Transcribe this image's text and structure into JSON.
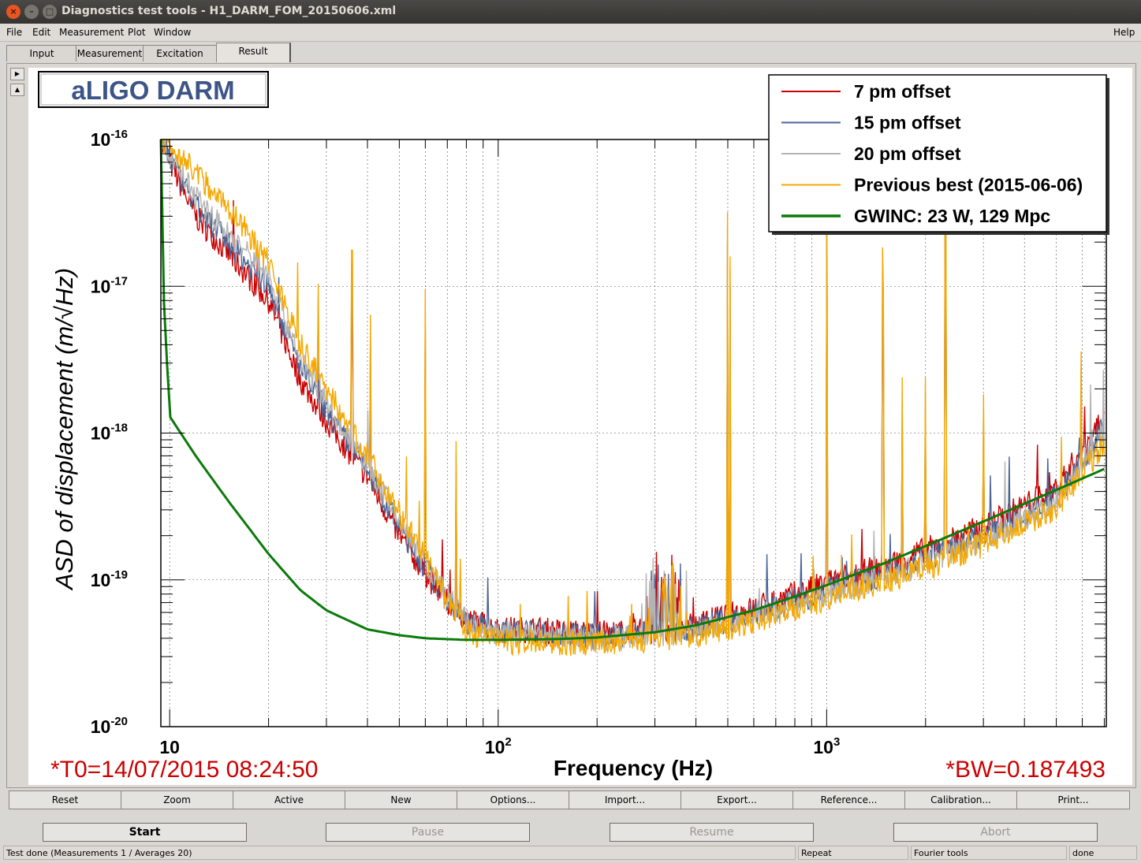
{
  "window": {
    "title": "Diagnostics test tools - H1_DARM_FOM_20150606.xml"
  },
  "menu": {
    "file": "File",
    "edit": "Edit",
    "measurement": "Measurement",
    "plot": "Plot",
    "window": "Window",
    "help": "Help"
  },
  "tabs": [
    "Input",
    "Measurement",
    "Excitation",
    "Result"
  ],
  "plot": {
    "header": "aLIGO DARM",
    "t0": "*T0=14/07/2015 08:24:50",
    "bw": "*BW=0.187493"
  },
  "chart_data": {
    "type": "line",
    "xscale": "log",
    "yscale": "log",
    "xlim": [
      9.4,
      7100
    ],
    "ylim": [
      1e-20,
      1e-16
    ],
    "xlabel": "Frequency (Hz)",
    "ylabel": "ASD of displacement  (m/√Hz)",
    "xticklabels": [
      "10",
      "10^2",
      "10^3"
    ],
    "yticklabels": [
      "10^-16",
      "10^-17",
      "10^-18",
      "10^-19",
      "10^-20"
    ],
    "grid": true,
    "legend_position": "top-right",
    "series": [
      {
        "name": "7 pm offset",
        "color": "#cc0000",
        "x": [
          9.5,
          10,
          12,
          15,
          20,
          25,
          30,
          40,
          50,
          60,
          70,
          80,
          100,
          130,
          160,
          200,
          300,
          400,
          600,
          800,
          1000,
          1500,
          2000,
          3000,
          5000,
          7000
        ],
        "y": [
          1e-16,
          7e-17,
          3e-17,
          1.7e-17,
          8e-18,
          2.3e-18,
          1.2e-18,
          5e-19,
          2e-19,
          1.1e-19,
          7e-20,
          5.4e-20,
          4.6e-20,
          4.6e-20,
          4.4e-20,
          4.3e-20,
          4.5e-20,
          5e-20,
          6.4e-20,
          8e-20,
          9.5e-20,
          1.25e-19,
          1.6e-19,
          2.3e-19,
          4.2e-19,
          1.3e-18
        ]
      },
      {
        "name": "15 pm offset",
        "color": "#4a6496",
        "x": [
          9.5,
          10,
          12,
          15,
          20,
          25,
          30,
          40,
          50,
          60,
          70,
          80,
          100,
          130,
          160,
          200,
          300,
          400,
          600,
          800,
          1000,
          1500,
          2000,
          3000,
          5000,
          7000
        ],
        "y": [
          1e-16,
          7.5e-17,
          3.5e-17,
          2e-17,
          1e-17,
          2.8e-18,
          1.4e-18,
          5.5e-19,
          2.3e-19,
          1.2e-19,
          7.5e-20,
          5.2e-20,
          4.4e-20,
          4.4e-20,
          4.2e-20,
          4.1e-20,
          4.3e-20,
          4.7e-20,
          5.8e-20,
          7.2e-20,
          8.5e-20,
          1.1e-19,
          1.4e-19,
          2e-19,
          3.6e-19,
          1.1e-18
        ]
      },
      {
        "name": "20 pm offset",
        "color": "#b4b4b4",
        "x": [
          9.5,
          10,
          12,
          15,
          20,
          25,
          30,
          40,
          50,
          60,
          70,
          80,
          100,
          130,
          160,
          200,
          300,
          400,
          600,
          800,
          1000,
          1500,
          2000,
          3000,
          5000,
          7000
        ],
        "y": [
          1e-16,
          8e-17,
          4e-17,
          2.3e-17,
          1.2e-17,
          3.2e-18,
          1.6e-18,
          6e-19,
          2.5e-19,
          1.3e-19,
          7.8e-20,
          5.2e-20,
          4.3e-20,
          4.3e-20,
          4.1e-20,
          4e-20,
          4.2e-20,
          4.5e-20,
          5.5e-20,
          6.8e-20,
          8e-20,
          1.05e-19,
          1.3e-19,
          1.9e-19,
          3.4e-19,
          1e-18
        ]
      },
      {
        "name": "Previous best (2015-06-06)",
        "color": "#f5a800",
        "x": [
          9.5,
          10,
          12,
          15,
          20,
          25,
          30,
          40,
          50,
          60,
          70,
          80,
          100,
          130,
          160,
          200,
          300,
          400,
          600,
          800,
          1000,
          1500,
          2000,
          3000,
          5000,
          7000
        ],
        "y": [
          1e-16,
          9e-17,
          6e-17,
          3.5e-17,
          1.5e-17,
          4e-18,
          2e-18,
          7e-19,
          2.8e-19,
          1.4e-19,
          7e-20,
          4.5e-20,
          3.8e-20,
          3.8e-20,
          3.7e-20,
          3.7e-20,
          3.9e-20,
          4.2e-20,
          5.2e-20,
          6.4e-20,
          7.5e-20,
          9.8e-20,
          1.2e-19,
          1.75e-19,
          3.1e-19,
          8.5e-19
        ]
      },
      {
        "name": "GWINC: 23 W, 129 Mpc",
        "color": "#0a7a0a",
        "x": [
          9.4,
          9.6,
          10,
          12,
          15,
          20,
          25,
          30,
          40,
          50,
          60,
          80,
          100,
          150,
          200,
          300,
          400,
          600,
          800,
          1000,
          1500,
          2000,
          3000,
          5000,
          7000
        ],
        "y": [
          1e-16,
          8e-18,
          1.3e-18,
          7e-19,
          3.5e-19,
          1.5e-19,
          8.5e-20,
          6.2e-20,
          4.6e-20,
          4.2e-20,
          4e-20,
          3.9e-20,
          3.9e-20,
          3.95e-20,
          4.05e-20,
          4.4e-20,
          4.9e-20,
          6.2e-20,
          7.7e-20,
          9.2e-20,
          1.3e-19,
          1.7e-19,
          2.5e-19,
          4.1e-19,
          5.7e-19
        ]
      }
    ],
    "lines_peaks": [
      {
        "x": 28.3,
        "y": 1.3e-17
      },
      {
        "x": 35.9,
        "y": 2.2e-17
      },
      {
        "x": 40.9,
        "y": 8e-18
      },
      {
        "x": 60,
        "y": 1.2e-17
      },
      {
        "x": 74.5,
        "y": 1.1e-18
      },
      {
        "x": 500,
        "y": 4e-17
      },
      {
        "x": 508,
        "y": 2e-17
      },
      {
        "x": 1000,
        "y": 1e-16
      },
      {
        "x": 1476,
        "y": 2.3e-17
      },
      {
        "x": 1484,
        "y": 1.2e-17
      },
      {
        "x": 1700,
        "y": 3e-18
      },
      {
        "x": 2000,
        "y": 3e-18
      },
      {
        "x": 2300,
        "y": 6e-17
      },
      {
        "x": 3000,
        "y": 2.3e-18
      },
      {
        "x": 5950,
        "y": 4.5e-18
      }
    ]
  },
  "toolbar": [
    "Reset",
    "Zoom",
    "Active",
    "New",
    "Options...",
    "Import...",
    "Export...",
    "Reference...",
    "Calibration...",
    "Print..."
  ],
  "actions": {
    "start": "Start",
    "pause": "Pause",
    "resume": "Resume",
    "abort": "Abort"
  },
  "status": {
    "message": "Test done (Measurements 1 / Averages 20)",
    "repeat": "Repeat",
    "tool": "Fourier tools",
    "state": "done"
  }
}
